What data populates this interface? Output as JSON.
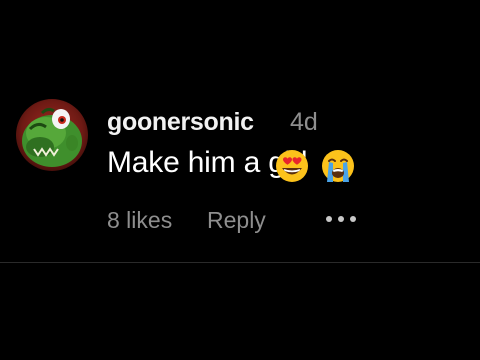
{
  "comment": {
    "avatar_icon": "green-dragon-avatar-icon",
    "username": "goonersonic",
    "time_ago": "4d",
    "text": "Make him a girl",
    "emojis": [
      "heart-eyes-emoji-icon",
      "loudly-crying-emoji-icon"
    ],
    "likes": "8 likes",
    "reply_label": "Reply",
    "more_icon": "more-options-icon"
  },
  "colors": {
    "background": "#000000",
    "username": "#f2f2f2",
    "secondary_text": "#8e8e8e",
    "body_text": "#ffffff"
  }
}
